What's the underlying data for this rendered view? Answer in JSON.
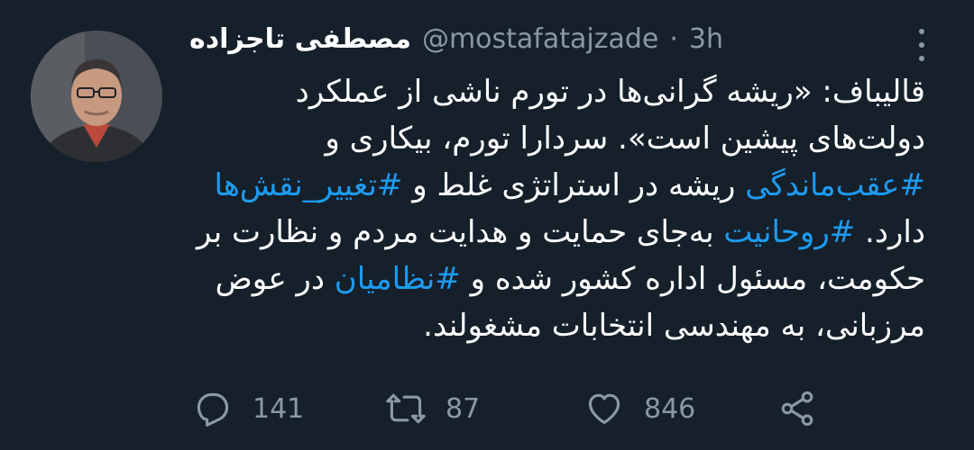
{
  "author": {
    "name": "مصطفی تاجزاده",
    "handle": "@mostafatajzade",
    "separator": "·",
    "time": "3h"
  },
  "tweet": {
    "lines": [
      [
        {
          "t": "قالیباف: «ریشه گرانی‌ها در تورم ناشی از عملکرد"
        }
      ],
      [
        {
          "t": "دولت‌های پیشین است». سردارا تورم، بیکاری و"
        }
      ],
      [
        {
          "t": "#عقب‌ماندگی",
          "h": true
        },
        {
          "t": " ریشه در استراتژی غلط و "
        },
        {
          "t": "#تغییر_نقش‌ها",
          "h": true
        }
      ],
      [
        {
          "t": "دارد. "
        },
        {
          "t": "#روحانیت",
          "h": true
        },
        {
          "t": " به‌جای حمایت و هدایت مردم و نظارت بر"
        }
      ],
      [
        {
          "t": "حکومت، مسئول اداره کشور شده و "
        },
        {
          "t": "#نظامیان",
          "h": true
        },
        {
          "t": " در عوض"
        }
      ],
      [
        {
          "t": "مرزبانی، به مهندسی انتخابات مشغولند."
        }
      ]
    ]
  },
  "actions": {
    "reply_count": "141",
    "retweet_count": "87",
    "like_count": "846"
  },
  "icons": {
    "reply": "speech-bubble-icon",
    "retweet": "retweet-arrows-icon",
    "like": "heart-icon",
    "share": "share-nodes-icon",
    "more": "vertical-ellipsis-icon"
  },
  "colors": {
    "background": "#15202b",
    "text": "#ffffff",
    "secondary": "#8b98a5",
    "hashtag": "#1d9bf0"
  }
}
